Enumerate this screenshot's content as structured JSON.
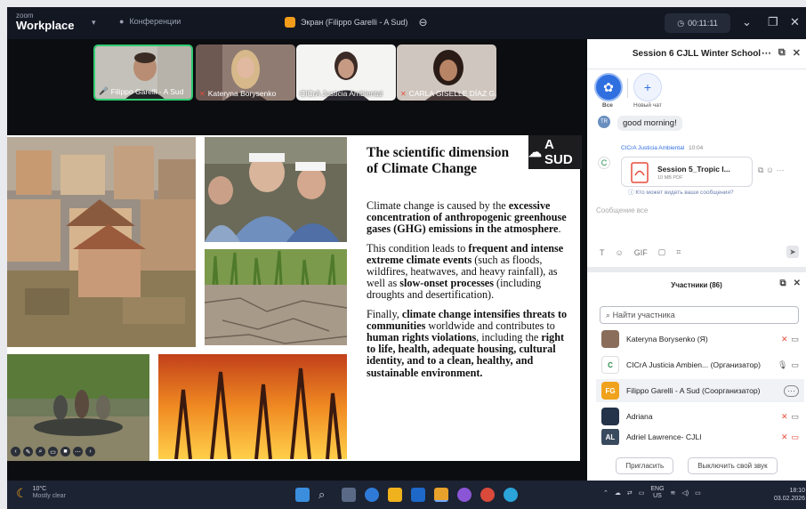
{
  "titlebar": {
    "brand_small": "zoom",
    "brand_big": "Workplace",
    "conf_label": "Конференции",
    "share_label": "Экран (Filippo Garelli - A Sud)",
    "timer": "00:11:11"
  },
  "thumbnails": [
    {
      "name": "Filippo Garelli - A Sud"
    },
    {
      "name": "Kateryna Borysenko"
    },
    {
      "name": "CICrA Justicia Ambiental"
    },
    {
      "name": "CARLA GISELLE DÍAZ G..."
    }
  ],
  "slide": {
    "logo": "A SUD",
    "title": "The scientific dimension of Climate Change",
    "p1_pre": "Climate change is caused by the ",
    "p1_bold": "excessive concentration of anthropogenic greenhouse gases (GHG) emissions in the atmosphere",
    "p1_post": ".",
    "p2_pre": "This condition leads to ",
    "p2_bold1": "frequent and intense extreme climate events",
    "p2_mid": " (such as floods, wildfires, heatwaves, and heavy rainfall), as well as ",
    "p2_bold2": "slow-onset processes",
    "p2_post": " (including droughts and desertification).",
    "p3_pre": "Finally, ",
    "p3_bold1": "climate change intensifies threats to communities",
    "p3_mid": " worldwide and contributes to ",
    "p3_bold2": "human rights violations",
    "p3_mid2": ", including the ",
    "p3_bold3": "right to life, health, adequate housing, cultural identity, and to a clean, healthy, and sustainable environment.",
    "p3_post": ""
  },
  "chat": {
    "title": "Session 6 CJLL Winter School",
    "tab_all": "Все",
    "tab_new": "Новый чат",
    "msg1_avatar": "TR",
    "msg1_text": "good morning!",
    "msg2_sender": "CICrA Justicia Ambiental",
    "msg2_time": "10:04",
    "file_name": "Session 5_Tropic I...",
    "file_sub": "10 MB PDF",
    "who_can": "Кто может видеть ваши сообщения?",
    "input_placeholder": "Сообщение все"
  },
  "participants": {
    "title": "Участники (86)",
    "search_placeholder": "Найти участника",
    "rows": [
      {
        "initials": "",
        "name": "Kateryna Borysenko (Я)",
        "color": "#8a6d5a"
      },
      {
        "initials": "",
        "name": "CICrA Justicia Ambien... (Организатор)",
        "color": "#ffffff"
      },
      {
        "initials": "FG",
        "name": "Filippo Garelli - A Sud (Соорганизатор)",
        "color": "#f0a21c"
      },
      {
        "initials": "",
        "name": "Adriana",
        "color": "#24324a"
      },
      {
        "initials": "AL",
        "name": "Adriel Lawrence- CJLI",
        "color": "#3a4a5e"
      }
    ],
    "invite_label": "Пригласить",
    "mute_all_label": "Выключить свой звук"
  },
  "taskbar": {
    "weather_temp": "10°C",
    "weather_desc": "Mostly clear",
    "lang1": "ENG",
    "lang2": "US",
    "time": "18:10",
    "date": "03.02.2026"
  }
}
